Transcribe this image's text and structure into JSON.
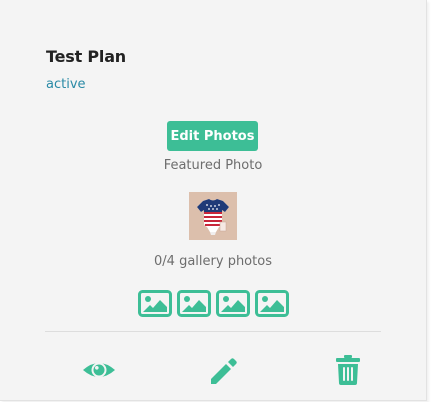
{
  "plan": {
    "title": "Test Plan",
    "status": "active"
  },
  "featured": {
    "edit_button_label": "Edit Photos",
    "label": "Featured Photo",
    "thumbnail_icon": "baby-onesie-american-flag-photo"
  },
  "gallery": {
    "count_label": "0/4 gallery photos",
    "slots": [
      {
        "icon": "image-placeholder-icon"
      },
      {
        "icon": "image-placeholder-icon"
      },
      {
        "icon": "image-placeholder-icon"
      },
      {
        "icon": "image-placeholder-icon"
      }
    ]
  },
  "actions": [
    {
      "name": "view",
      "icon": "eye-icon"
    },
    {
      "name": "edit",
      "icon": "pencil-icon"
    },
    {
      "name": "delete",
      "icon": "trash-icon"
    }
  ],
  "colors": {
    "accent": "#3dbe96",
    "status": "#2a8aa6",
    "card_background": "#f4f4f4"
  }
}
